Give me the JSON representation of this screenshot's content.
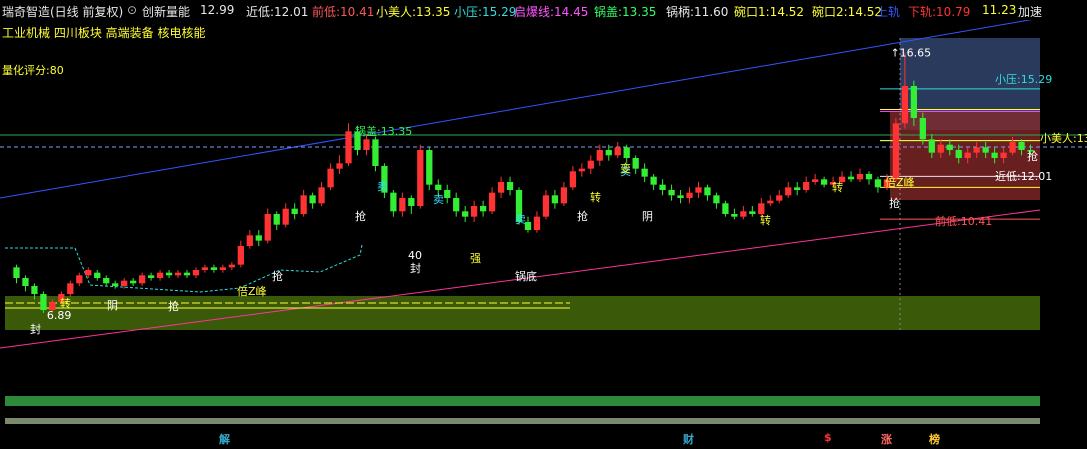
{
  "header": {
    "stock_name": "瑞奇智造(日线 前复权)",
    "dropdown_icon": "chevron-down-icon",
    "indicator_name": "创新量能",
    "items": [
      {
        "label": "",
        "value": "12.99",
        "color": "#e8e8e8"
      },
      {
        "label": "近低:",
        "value": "12.01",
        "color": "#e8e8e8"
      },
      {
        "label": "前低:",
        "value": "10.41",
        "color": "#ff5555"
      },
      {
        "label": "小美人:",
        "value": "13.35",
        "color": "#ffff33"
      },
      {
        "label": "小压:",
        "value": "15.29",
        "color": "#33dddd"
      },
      {
        "label": "启爆线:",
        "value": "14.45",
        "color": "#ff55ff"
      },
      {
        "label": "锅盖:",
        "value": "13.35",
        "color": "#33ff66"
      },
      {
        "label": "锅柄:",
        "value": "11.60",
        "color": "#e8e8e8"
      },
      {
        "label": "碗口1:",
        "value": "14.52",
        "color": "#ffff33"
      },
      {
        "label": "碗口2:",
        "value": "14.52",
        "color": "#ffff33"
      },
      {
        "label": "上轨",
        "value": "",
        "color": "#3355ff"
      },
      {
        "label": "下轨:",
        "value": "10.79",
        "color": "#ff3333"
      },
      {
        "label": "",
        "value": "11.23",
        "color": "#ffff33"
      },
      {
        "label": "加速",
        "value": "",
        "color": "#e8e8e8"
      }
    ]
  },
  "concepts": "工业机械 四川板块 高端装备 核电核能",
  "score_label": "量化评分:80",
  "chart_data": {
    "type": "candlestick",
    "price_range": [
      5.5,
      17.5
    ],
    "period_high": "16.65",
    "period_low": "6.89",
    "candles": [
      [
        8.6,
        8.2,
        8.7,
        8.0
      ],
      [
        8.2,
        7.9,
        8.3,
        7.7
      ],
      [
        7.9,
        7.6,
        8.0,
        7.4
      ],
      [
        7.6,
        7.0,
        7.7,
        6.89
      ],
      [
        7.0,
        7.3,
        7.4,
        6.9
      ],
      [
        7.3,
        7.6,
        7.7,
        7.2
      ],
      [
        7.6,
        8.0,
        8.1,
        7.5
      ],
      [
        8.0,
        8.3,
        8.4,
        7.9
      ],
      [
        8.3,
        8.5,
        8.6,
        8.2
      ],
      [
        8.4,
        8.2,
        8.5,
        8.1
      ],
      [
        8.2,
        8.0,
        8.3,
        7.9
      ],
      [
        8.0,
        7.9,
        8.1,
        7.8
      ],
      [
        7.9,
        8.1,
        8.2,
        7.8
      ],
      [
        8.1,
        8.0,
        8.2,
        7.9
      ],
      [
        8.0,
        8.3,
        8.4,
        7.9
      ],
      [
        8.3,
        8.2,
        8.4,
        8.1
      ],
      [
        8.2,
        8.4,
        8.5,
        8.1
      ],
      [
        8.4,
        8.3,
        8.5,
        8.2
      ],
      [
        8.3,
        8.4,
        8.5,
        8.2
      ],
      [
        8.4,
        8.3,
        8.5,
        8.2
      ],
      [
        8.3,
        8.5,
        8.6,
        8.2
      ],
      [
        8.5,
        8.6,
        8.7,
        8.4
      ],
      [
        8.6,
        8.5,
        8.7,
        8.4
      ],
      [
        8.5,
        8.6,
        8.7,
        8.4
      ],
      [
        8.6,
        8.7,
        8.8,
        8.5
      ],
      [
        8.7,
        9.4,
        9.6,
        8.6
      ],
      [
        9.4,
        9.8,
        10.0,
        9.3
      ],
      [
        9.8,
        9.6,
        10.0,
        9.4
      ],
      [
        9.6,
        10.6,
        10.8,
        9.5
      ],
      [
        10.6,
        10.2,
        10.7,
        10.0
      ],
      [
        10.2,
        10.8,
        11.0,
        10.1
      ],
      [
        10.8,
        10.6,
        11.0,
        10.4
      ],
      [
        10.6,
        11.3,
        11.5,
        10.5
      ],
      [
        11.3,
        11.0,
        11.4,
        10.8
      ],
      [
        11.0,
        11.6,
        11.8,
        10.9
      ],
      [
        11.6,
        12.3,
        12.5,
        11.5
      ],
      [
        12.3,
        12.5,
        12.8,
        12.1
      ],
      [
        12.5,
        13.7,
        14.0,
        12.4
      ],
      [
        13.7,
        13.0,
        13.9,
        12.8
      ],
      [
        13.0,
        13.4,
        13.6,
        12.8
      ],
      [
        13.4,
        12.4,
        13.5,
        12.2
      ],
      [
        12.4,
        11.4,
        12.5,
        11.2
      ],
      [
        11.4,
        10.7,
        11.5,
        10.5
      ],
      [
        10.7,
        11.2,
        11.4,
        10.5
      ],
      [
        11.2,
        10.9,
        11.3,
        10.6
      ],
      [
        10.9,
        13.0,
        13.2,
        10.8
      ],
      [
        13.0,
        11.7,
        13.1,
        11.5
      ],
      [
        11.7,
        11.5,
        11.9,
        11.3
      ],
      [
        11.5,
        11.2,
        11.7,
        11.0
      ],
      [
        11.2,
        10.7,
        11.4,
        10.5
      ],
      [
        10.7,
        10.5,
        10.9,
        10.3
      ],
      [
        10.5,
        10.9,
        11.1,
        10.3
      ],
      [
        10.9,
        10.7,
        11.1,
        10.5
      ],
      [
        10.7,
        11.4,
        11.6,
        10.6
      ],
      [
        11.4,
        11.8,
        12.0,
        11.2
      ],
      [
        11.8,
        11.5,
        12.0,
        11.3
      ],
      [
        11.5,
        10.3,
        11.6,
        10.2
      ],
      [
        10.3,
        10.0,
        10.5,
        9.9
      ],
      [
        10.0,
        10.5,
        10.7,
        9.9
      ],
      [
        10.5,
        11.3,
        11.5,
        10.4
      ],
      [
        11.3,
        11.0,
        11.5,
        10.8
      ],
      [
        11.0,
        11.6,
        11.8,
        10.9
      ],
      [
        11.6,
        12.2,
        12.4,
        11.5
      ],
      [
        12.2,
        12.3,
        12.5,
        12.0
      ],
      [
        12.3,
        12.6,
        12.8,
        12.1
      ],
      [
        12.6,
        13.0,
        13.2,
        12.4
      ],
      [
        13.0,
        12.8,
        13.2,
        12.6
      ],
      [
        12.8,
        13.1,
        13.3,
        12.7
      ],
      [
        13.1,
        12.7,
        13.2,
        12.5
      ],
      [
        12.7,
        12.3,
        12.8,
        12.1
      ],
      [
        12.3,
        12.0,
        12.5,
        11.8
      ],
      [
        12.0,
        11.7,
        12.1,
        11.5
      ],
      [
        11.7,
        11.5,
        11.9,
        11.3
      ],
      [
        11.5,
        11.3,
        11.7,
        11.1
      ],
      [
        11.3,
        11.2,
        11.5,
        11.0
      ],
      [
        11.2,
        11.4,
        11.6,
        11.0
      ],
      [
        11.4,
        11.6,
        11.8,
        11.2
      ],
      [
        11.6,
        11.3,
        11.7,
        11.1
      ],
      [
        11.3,
        11.0,
        11.4,
        10.8
      ],
      [
        11.0,
        10.6,
        11.1,
        10.5
      ],
      [
        10.6,
        10.5,
        10.8,
        10.4
      ],
      [
        10.5,
        10.7,
        10.9,
        10.4
      ],
      [
        10.7,
        10.6,
        10.9,
        10.5
      ],
      [
        10.6,
        11.0,
        11.2,
        10.5
      ],
      [
        11.0,
        11.1,
        11.3,
        10.9
      ],
      [
        11.1,
        11.3,
        11.5,
        11.0
      ],
      [
        11.3,
        11.6,
        11.8,
        11.2
      ],
      [
        11.6,
        11.5,
        11.8,
        11.3
      ],
      [
        11.5,
        11.8,
        12.0,
        11.4
      ],
      [
        11.8,
        11.9,
        12.1,
        11.7
      ],
      [
        11.9,
        11.7,
        12.0,
        11.6
      ],
      [
        11.7,
        11.8,
        12.0,
        11.6
      ],
      [
        11.8,
        12.0,
        12.2,
        11.7
      ],
      [
        12.0,
        11.9,
        12.2,
        11.8
      ],
      [
        11.9,
        12.1,
        12.3,
        11.8
      ],
      [
        12.1,
        11.9,
        12.2,
        11.7
      ],
      [
        11.9,
        11.6,
        12.0,
        11.4
      ],
      [
        11.6,
        11.9,
        12.1,
        11.5
      ],
      [
        11.9,
        14.0,
        14.2,
        11.8
      ],
      [
        14.0,
        15.4,
        16.65,
        13.8
      ],
      [
        15.4,
        14.2,
        15.6,
        13.9
      ],
      [
        14.2,
        13.4,
        14.4,
        13.2
      ],
      [
        13.4,
        12.9,
        13.6,
        12.7
      ],
      [
        12.9,
        13.2,
        13.4,
        12.7
      ],
      [
        13.2,
        13.0,
        13.4,
        12.8
      ],
      [
        13.0,
        12.7,
        13.2,
        12.5
      ],
      [
        12.7,
        12.9,
        13.1,
        12.5
      ],
      [
        12.9,
        13.1,
        13.3,
        12.7
      ],
      [
        13.1,
        12.9,
        13.3,
        12.7
      ],
      [
        12.9,
        12.7,
        13.1,
        12.5
      ],
      [
        12.7,
        12.9,
        13.1,
        12.5
      ],
      [
        12.9,
        13.3,
        13.5,
        12.8
      ],
      [
        13.3,
        13.0,
        13.4,
        12.8
      ],
      [
        13.0,
        12.99,
        13.2,
        12.8
      ]
    ],
    "horizontal_levels": [
      {
        "name": "锅盖",
        "value": 13.35,
        "color": "#33cc66",
        "label": "锅盖:13.35"
      },
      {
        "name": "小压",
        "value": 15.29,
        "color": "#33dddd",
        "label": "小压:15.29"
      },
      {
        "name": "启爆线",
        "value": 14.45,
        "color": "#ff55ff",
        "label": "启爆线:14.45"
      },
      {
        "name": "碗口",
        "value": 14.52,
        "color": "#ffff33",
        "label": ""
      },
      {
        "name": "锅柄",
        "value": 11.6,
        "color": "#ffff33",
        "label": "锅柄:11.60"
      },
      {
        "name": "近低",
        "value": 12.01,
        "color": "#e8e8e8",
        "label": "近低:12.01"
      },
      {
        "name": "前低",
        "value": 10.41,
        "color": "#ff5555",
        "label": "前低:10.41"
      },
      {
        "name": "小美人",
        "value": 13.35,
        "color": "#ffff33",
        "label": "小美人:13.35"
      }
    ],
    "annotations": [
      "卖",
      "卖",
      "卖",
      "卖",
      "抢",
      "抢",
      "抢",
      "抢",
      "抢",
      "封",
      "封",
      "封",
      "封",
      "转",
      "转",
      "转",
      "转",
      "阴",
      "阴",
      "倍Z峰",
      "倍Z峰",
      "锅底",
      "强",
      "变",
      "涨",
      "40",
      "6.89"
    ],
    "bottom_tags": [
      {
        "text": "解",
        "color": "#33aacc"
      },
      {
        "text": "财",
        "color": "#33aacc"
      },
      {
        "text": "$",
        "color": "#ff3333"
      },
      {
        "text": "涨",
        "color": "#ff6666"
      },
      {
        "text": "榜",
        "color": "#ffcc33"
      }
    ]
  }
}
